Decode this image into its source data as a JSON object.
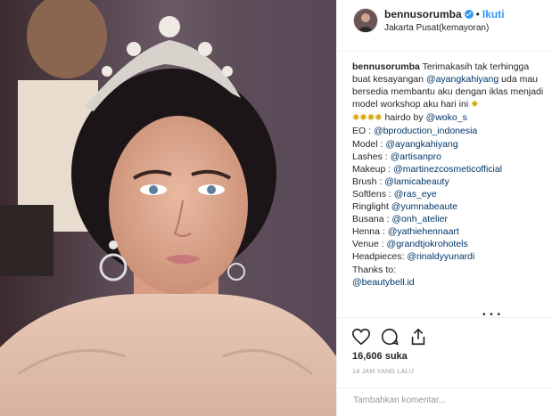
{
  "post": {
    "username": "bennusorumba",
    "follow_label": "Ikuti",
    "location": "Jakarta Pusat(kemayoran)"
  },
  "caption": {
    "username": "bennusorumba",
    "intro": "Terimakasih tak terhingga buat kesayangan",
    "intro_mention": "@ayangkahiyang",
    "intro_rest": "uda mau bersedia membantu aku dengan iklas menjadi model workshop aku hari ini",
    "hairdo_label": "hairdo by",
    "hairdo_mention": "@woko_s",
    "credits": [
      {
        "label": "EO :",
        "mention": "@bproduction_indonesia"
      },
      {
        "label": "Model :",
        "mention": "@ayangkahiyang"
      },
      {
        "label": "Lashes :",
        "mention": "@artisanpro"
      },
      {
        "label": "Makeup :",
        "mention": "@martinezcosmeticofficial"
      },
      {
        "label": "Brush :",
        "mention": "@lamicabeauty"
      },
      {
        "label": "Softlens :",
        "mention": "@ras_eye"
      },
      {
        "label": "Ringlight",
        "mention": "@yumnabeaute"
      },
      {
        "label": "Busana :",
        "mention": "@onh_atelier"
      },
      {
        "label": "Henna :",
        "mention": "@yathiehennaart"
      },
      {
        "label": "Venue :",
        "mention": "@grandtjokrohotels"
      },
      {
        "label": "Headpieces:",
        "mention": "@rinaldyyunardi"
      }
    ],
    "thanks_label": "Thanks to:",
    "thanks_mention": "@beautybell.id"
  },
  "stats": {
    "likes": "16,606 suka",
    "time": "14 JAM YANG LALU"
  },
  "comment": {
    "placeholder": "Tambahkan komentar..."
  },
  "icons": [
    "heart-icon",
    "comment-icon",
    "share-icon",
    "verified-badge-icon",
    "sparkle-emoji-icon"
  ],
  "colors": {
    "link": "#3897f0",
    "mention": "#003569",
    "verified": "#3897f0"
  }
}
